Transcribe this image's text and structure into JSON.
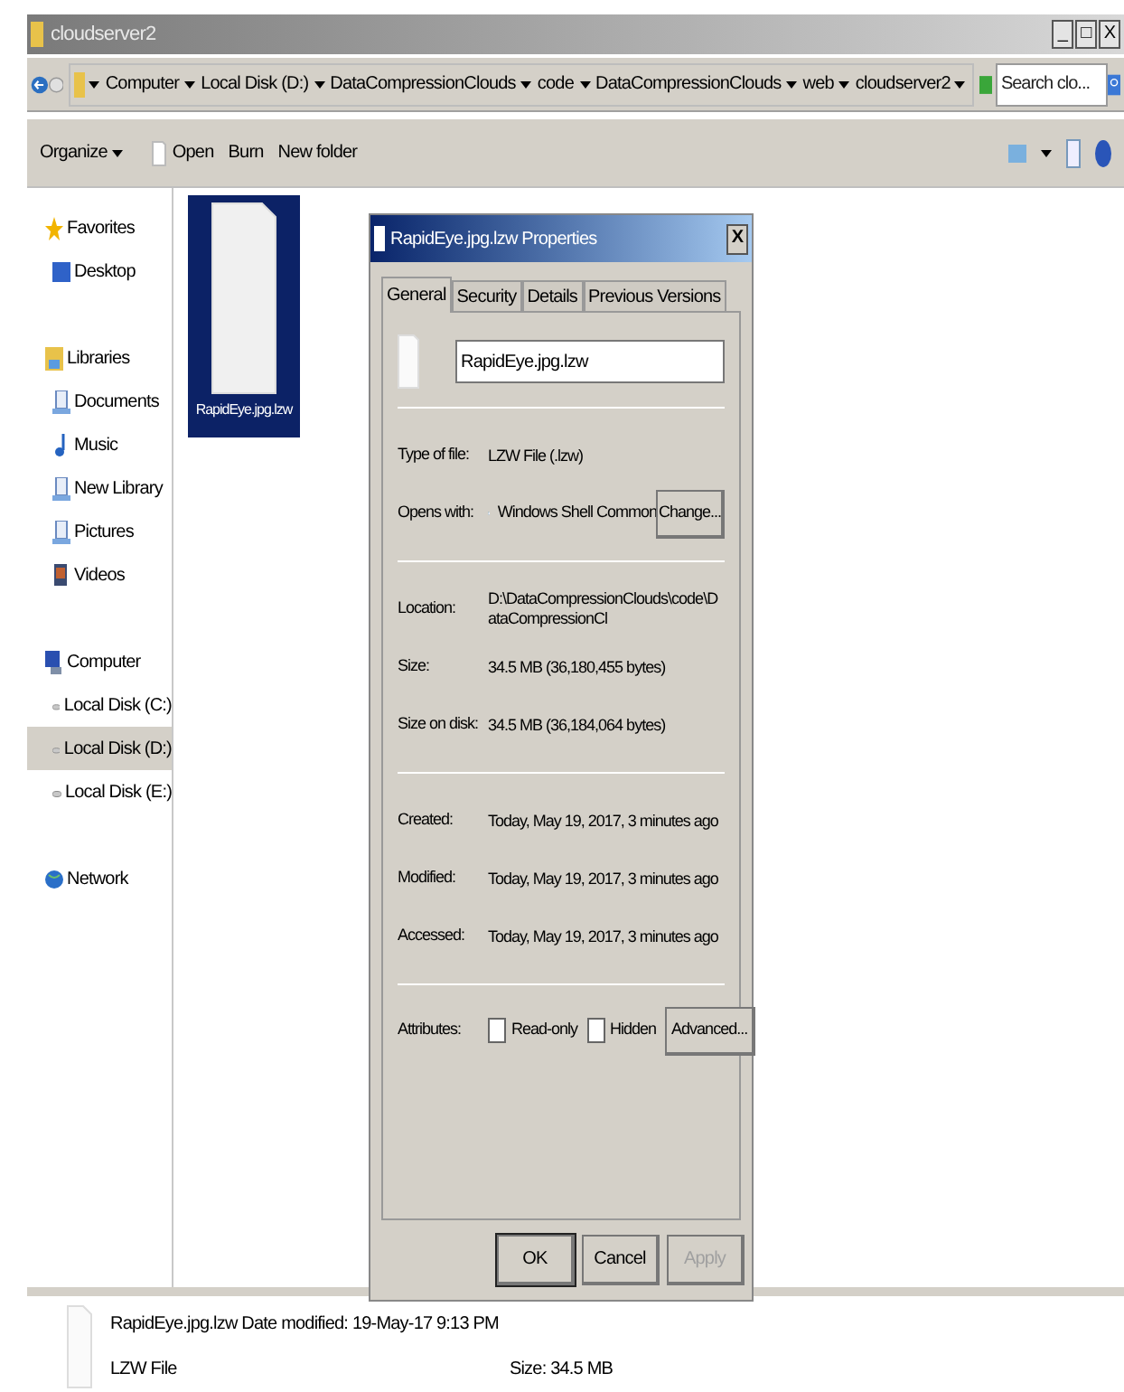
{
  "window": {
    "title": "cloudserver2",
    "controls": [
      "_",
      "□",
      "X"
    ]
  },
  "address_bar": {
    "crumbs": [
      "Computer",
      "Local Disk (D:)",
      "DataCompressionClouds",
      "code",
      "DataCompressionClouds",
      "web",
      "cloudserver2"
    ],
    "search_placeholder": "Search clo..."
  },
  "toolbar": {
    "items": [
      {
        "label": "Organize",
        "kind": "menu"
      },
      {
        "label": "Open",
        "kind": "file"
      },
      {
        "label": "Burn",
        "kind": "plain"
      },
      {
        "label": "New folder",
        "kind": "plain"
      }
    ]
  },
  "sidebar": {
    "groups": [
      {
        "label": "Favorites",
        "selected": false,
        "children": [
          {
            "label": "Desktop",
            "selected": false
          }
        ]
      },
      {
        "label": "Libraries",
        "selected": false,
        "children": [
          {
            "label": "Documents",
            "selected": false
          },
          {
            "label": "Music",
            "selected": false
          },
          {
            "label": "New Library",
            "selected": false
          },
          {
            "label": "Pictures",
            "selected": false
          },
          {
            "label": "Videos",
            "selected": false
          }
        ]
      },
      {
        "label": "Computer",
        "selected": false,
        "children": [
          {
            "label": "Local Disk (C:)",
            "selected": false
          },
          {
            "label": "Local Disk (D:)",
            "selected": true
          },
          {
            "label": "Local Disk (E:)",
            "selected": false
          }
        ]
      },
      {
        "label": "Network",
        "selected": false
      }
    ]
  },
  "files": [
    {
      "name": "RapidEye.jpg.lzw",
      "selected": true
    }
  ],
  "details_pane": {
    "name": "RapidEye.jpg.lzw",
    "modified": "Date modified: 19-May-17 9:13 PM",
    "type": "LZW File",
    "size": "Size: 34.5 MB"
  },
  "dialog": {
    "title": "RapidEye.jpg.lzw Properties",
    "close": "X",
    "tabs": [
      {
        "label": "General",
        "selected": true
      },
      {
        "label": "Security",
        "selected": false
      },
      {
        "label": "Details",
        "selected": false
      },
      {
        "label": "Previous Versions",
        "selected": false
      }
    ],
    "filename": "RapidEye.jpg.lzw",
    "sections": [
      [
        {
          "label": "Type of file:",
          "value": "LZW File (.lzw)"
        },
        {
          "label": "Opens with:",
          "value": "Windows Shell Common",
          "button": "Change..."
        }
      ],
      [
        {
          "label": "Location:",
          "value": "D:\\DataCompressionClouds\\code\\DataCompressionCl"
        },
        {
          "label": "Size:",
          "value": "34.5 MB (36,180,455 bytes)"
        },
        {
          "label": "Size on disk:",
          "value": "34.5 MB (36,184,064 bytes)"
        }
      ],
      [
        {
          "label": "Created:",
          "value": "Today, May 19, 2017, 3 minutes ago"
        },
        {
          "label": "Modified:",
          "value": "Today, May 19, 2017, 3 minutes ago"
        },
        {
          "label": "Accessed:",
          "value": "Today, May 19, 2017, 3 minutes ago"
        }
      ]
    ],
    "attributes": {
      "label": "Attributes:",
      "items": [
        {
          "label": "Read-only",
          "checked": false
        },
        {
          "label": "Hidden",
          "checked": false
        }
      ],
      "button": "Advanced..."
    },
    "buttons": [
      {
        "label": "OK",
        "disabled": false
      },
      {
        "label": "Cancel",
        "disabled": false
      },
      {
        "label": "Apply",
        "disabled": true
      }
    ]
  }
}
